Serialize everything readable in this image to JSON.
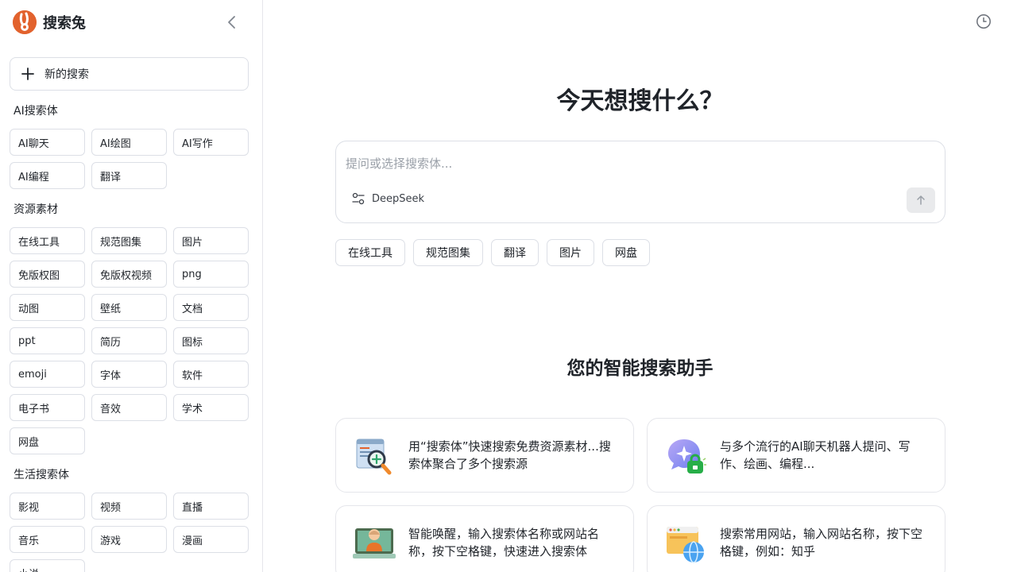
{
  "brand": {
    "name": "搜索兔"
  },
  "sidebar": {
    "new_search": "新的搜索",
    "sections": [
      {
        "title": "AI搜索体",
        "items": [
          "AI聊天",
          "AI绘图",
          "AI写作",
          "AI编程",
          "翻译"
        ]
      },
      {
        "title": "资源素材",
        "items": [
          "在线工具",
          "规范图集",
          "图片",
          "免版权图",
          "免版权视频",
          "png",
          "动图",
          "壁纸",
          "文档",
          "ppt",
          "简历",
          "图标",
          "emoji",
          "字体",
          "软件",
          "电子书",
          "音效",
          "学术",
          "网盘"
        ]
      },
      {
        "title": "生活搜索体",
        "items": [
          "影视",
          "视频",
          "直播",
          "音乐",
          "游戏",
          "漫画",
          "小说"
        ]
      }
    ]
  },
  "main": {
    "headline": "今天想搜什么？",
    "search": {
      "placeholder": "提问或选择搜索体...",
      "value": "",
      "model": "DeepSeek"
    },
    "quick_tags": [
      "在线工具",
      "规范图集",
      "翻译",
      "图片",
      "网盘"
    ],
    "subhead": "您的智能搜索助手",
    "features": [
      {
        "icon": "magnifier-document-icon",
        "text": "用“搜索体”快速搜索免费资源素材...搜索体聚合了多个搜索源"
      },
      {
        "icon": "ai-chat-lock-icon",
        "text": "与多个流行的AI聊天机器人提问、写作、绘画、编程..."
      },
      {
        "icon": "person-laptop-icon",
        "text": "智能唤醒，输入搜索体名称或网站名称，按下空格键，快速进入搜索体"
      },
      {
        "icon": "browser-globe-icon",
        "text": "搜索常用网站，输入网站名称，按下空格键，例如：知乎"
      }
    ]
  },
  "colors": {
    "brand": "#e2622d",
    "border": "#dcdfe6",
    "send_disabled": "#e9eaec"
  }
}
